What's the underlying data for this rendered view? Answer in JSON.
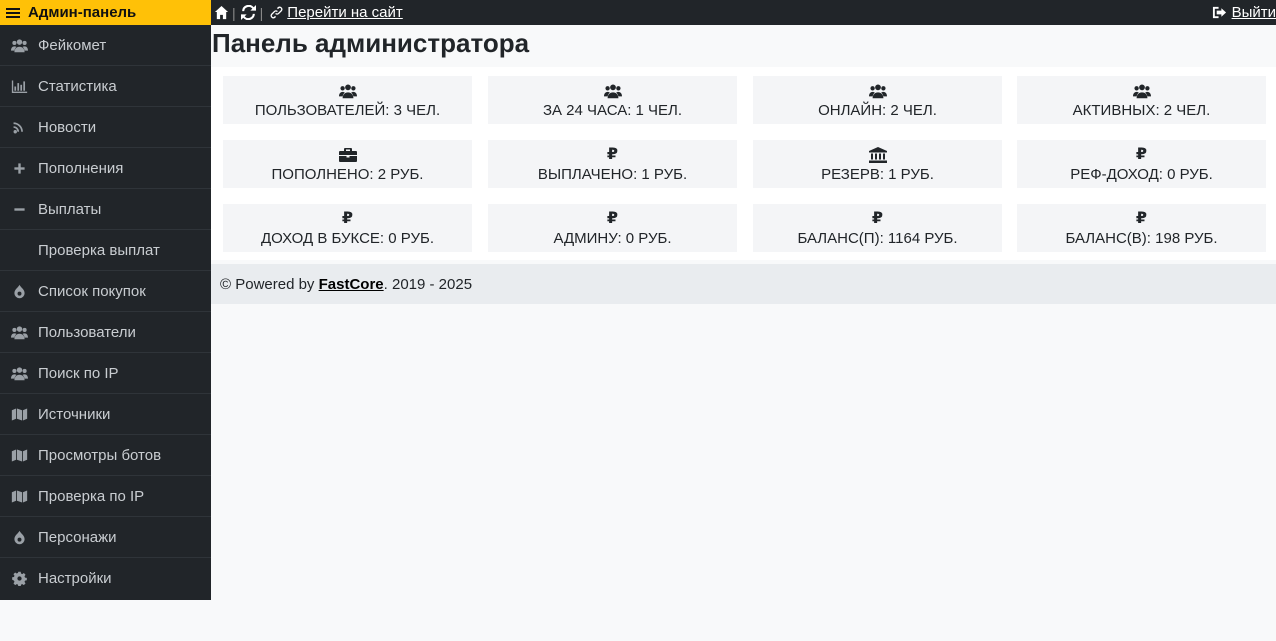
{
  "sidebar": {
    "title": "Админ-панель",
    "items": [
      {
        "label": "Фейкомет",
        "icon": "users-icon"
      },
      {
        "label": "Статистика",
        "icon": "bar-chart-icon"
      },
      {
        "label": "Новости",
        "icon": "rss-icon"
      },
      {
        "label": "Пополнения",
        "icon": "plus-icon"
      },
      {
        "label": "Выплаты",
        "icon": "minus-icon"
      },
      {
        "label": "Проверка выплат",
        "icon": ""
      },
      {
        "label": "Список покупок",
        "icon": "drupal-icon"
      },
      {
        "label": "Пользователи",
        "icon": "users-icon"
      },
      {
        "label": "Поиск по IP",
        "icon": "users-icon"
      },
      {
        "label": "Источники",
        "icon": "map-icon"
      },
      {
        "label": "Просмотры ботов",
        "icon": "map-icon"
      },
      {
        "label": "Проверка по IP",
        "icon": "map-icon"
      },
      {
        "label": "Персонажи",
        "icon": "drupal-icon"
      },
      {
        "label": "Настройки",
        "icon": "gear-icon"
      }
    ]
  },
  "topbar": {
    "goto_site": "Перейти на сайт",
    "logout": "Выйти"
  },
  "main": {
    "title": "Панель администратора"
  },
  "stats": [
    {
      "label": "ПОЛЬЗОВАТЕЛЕЙ: 3 ЧЕЛ.",
      "icon": "users-icon"
    },
    {
      "label": "ЗА 24 ЧАСА: 1 ЧЕЛ.",
      "icon": "users-icon"
    },
    {
      "label": "ОНЛАЙН: 2 ЧЕЛ.",
      "icon": "users-icon"
    },
    {
      "label": "АКТИВНЫХ: 2 ЧЕЛ.",
      "icon": "users-icon"
    },
    {
      "label": "ПОПОЛНЕНО: 2 РУБ.",
      "icon": "briefcase-icon"
    },
    {
      "label": "ВЫПЛАЧЕНО: 1 РУБ.",
      "icon": "ruble-icon"
    },
    {
      "label": "РЕЗЕРВ: 1 РУБ.",
      "icon": "bank-icon"
    },
    {
      "label": "РЕФ-ДОХОД: 0 РУБ.",
      "icon": "ruble-icon"
    },
    {
      "label": "ДОХОД В БУКСЕ: 0 РУБ.",
      "icon": "ruble-icon"
    },
    {
      "label": "АДМИНУ: 0 РУБ.",
      "icon": "ruble-icon"
    },
    {
      "label": "БАЛАНС(П): 1164 РУБ.",
      "icon": "ruble-icon"
    },
    {
      "label": "БАЛАНС(В): 198 РУБ.",
      "icon": "ruble-icon"
    }
  ],
  "footer": {
    "prefix": "© Powered by ",
    "brand": "FastCore",
    "suffix": ". 2019 - 2025"
  },
  "colors": {
    "accent": "#ffc107",
    "sidebar_bg": "#212529",
    "page_bg": "#f8f9fa"
  }
}
